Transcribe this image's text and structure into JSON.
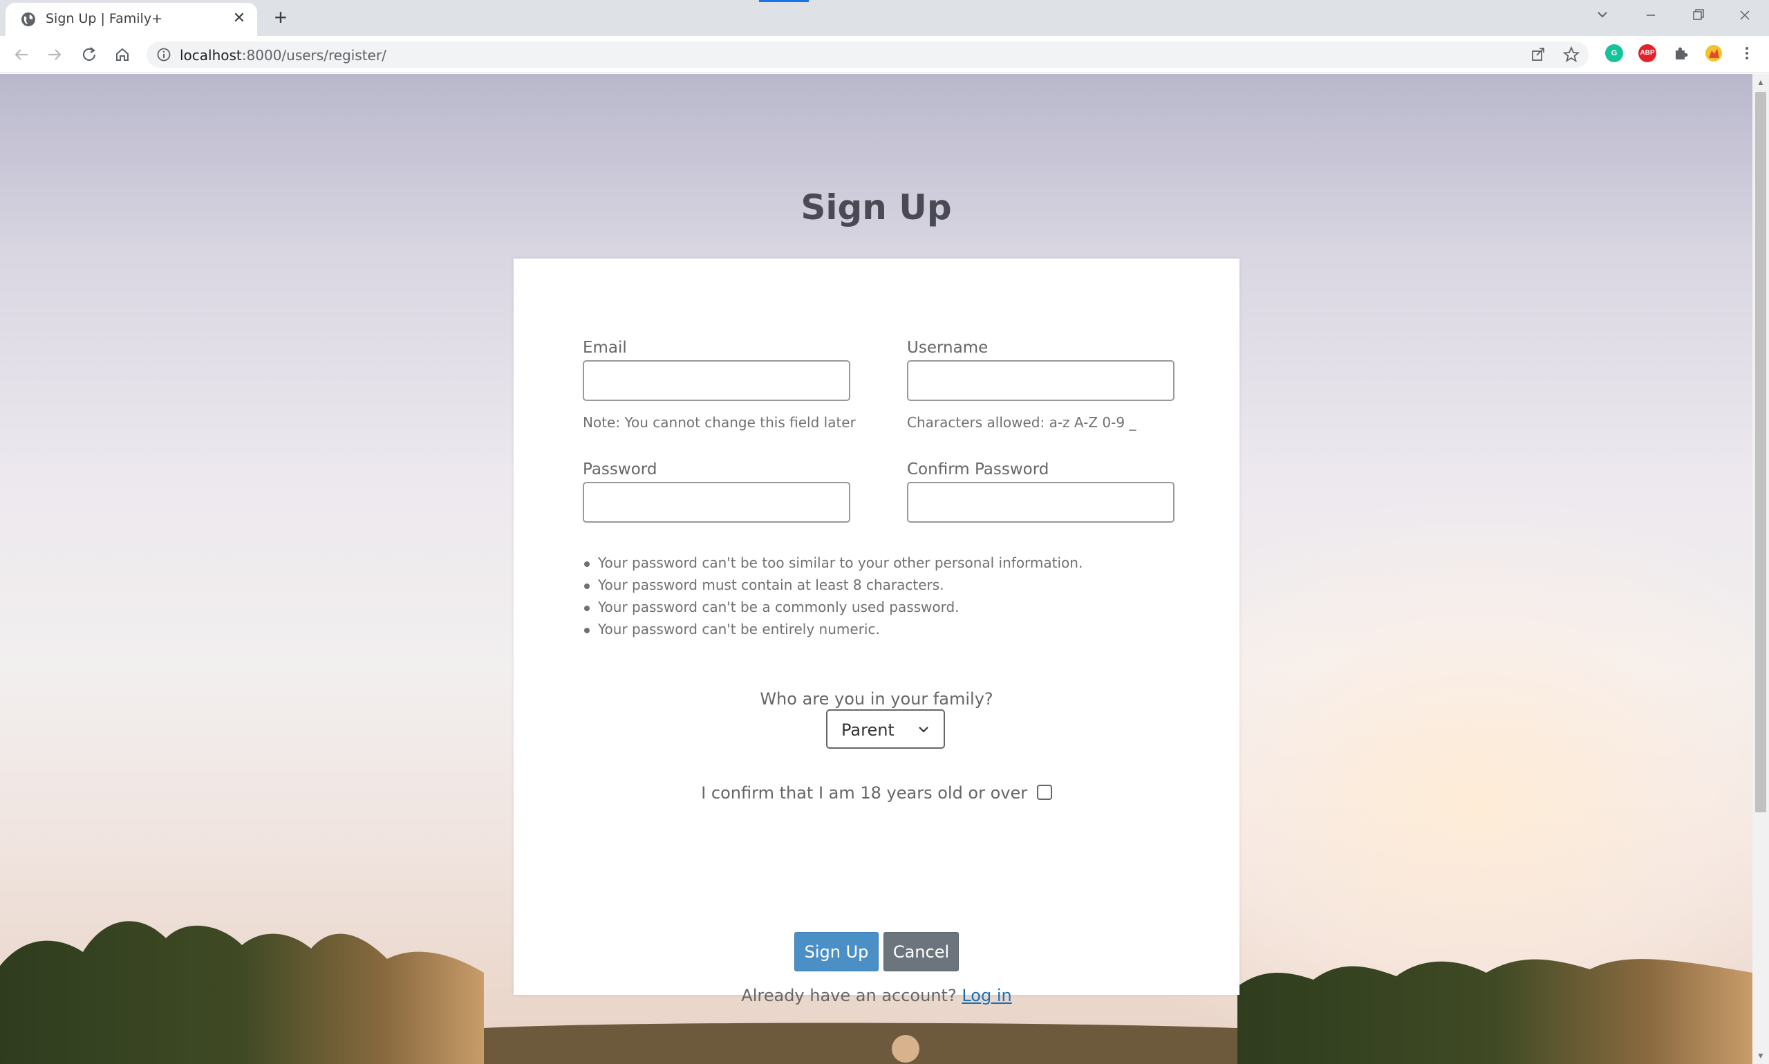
{
  "browser": {
    "tab_title": "Sign Up | Family+",
    "tab_close": "✕",
    "new_tab": "+",
    "url_host": "localhost",
    "url_path": ":8000/users/register/",
    "extensions": [
      {
        "name": "grammarly",
        "label": "G",
        "color": "#15c39a"
      },
      {
        "name": "adblock-plus",
        "label": "ABP",
        "color": "#e4212b"
      }
    ]
  },
  "page": {
    "title": "Sign Up",
    "email_label": "Email",
    "email_help": "Note: You cannot change this field later",
    "username_label": "Username",
    "username_help": "Characters allowed: a-z A-Z 0-9 _",
    "password_label": "Password",
    "confirm_password_label": "Confirm Password",
    "password_rules": [
      "Your password can't be too similar to your other personal information.",
      "Your password must contain at least 8 characters.",
      "Your password can't be a commonly used password.",
      "Your password can't be entirely numeric."
    ],
    "role_label": "Who are you in your family?",
    "role_selected": "Parent",
    "age_confirm_label": "I confirm that I am 18 years old or over",
    "signup_button": "Sign Up",
    "cancel_button": "Cancel",
    "login_prompt": "Already have an account?",
    "login_link": "Log in"
  }
}
